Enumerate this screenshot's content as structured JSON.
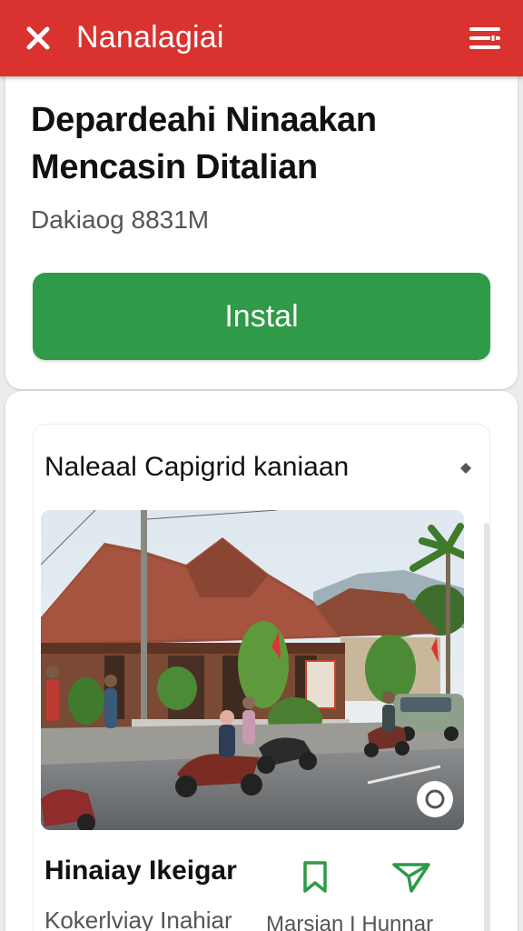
{
  "header": {
    "title": "Nanalagiai",
    "close_icon": "close-icon",
    "menu_icon": "menu-icon",
    "color": "#d9322f"
  },
  "app": {
    "headline": "Depardeahi Ninaakan Mencasin Ditalian",
    "size": "Dakiaog 8831M",
    "install_label": "Instal",
    "install_color": "#2f9a47"
  },
  "feature": {
    "title": "Naleaal Capigrid kaniaan",
    "more_icon": "diamond-icon",
    "photo_alt": "Village street with traditional tiled-roof house, motorbikes and palm trees",
    "caption_title": "Hinaiay Ikeigar",
    "caption_sub": "Kokerlviay Inahiar",
    "action_label": "Marsian I Hunnar",
    "bookmark_icon": "bookmark-icon",
    "send_icon": "send-icon",
    "accent": "#2f9a47"
  }
}
